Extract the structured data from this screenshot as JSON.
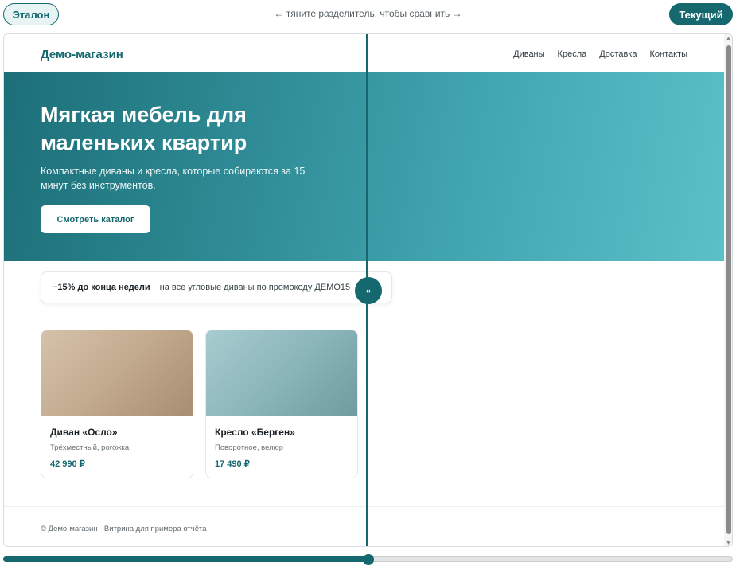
{
  "toolbar": {
    "reference_label": "Эталон",
    "current_label": "Текущий",
    "hint": "← тяните разделитель, чтобы сравнить →"
  },
  "site": {
    "logo": "Демо-магазин",
    "nav": [
      "Диваны",
      "Кресла",
      "Доставка",
      "Контакты"
    ],
    "hero": {
      "title": "Мягкая мебель для маленьких квартир",
      "subtitle": "Компактные диваны и кресла, которые собираются за 15 минут без инструментов.",
      "button": "Смотреть каталог"
    },
    "promo": {
      "strong": "−15% до конца недели",
      "text": "на все угловые диваны по промокоду ДЕМО15"
    },
    "products": [
      {
        "title": "Диван «Осло»",
        "desc": "Трёхместный, рогожка",
        "price": "42 990 ₽"
      },
      {
        "title": "Кресло «Берген»",
        "desc": "Поворотное, велюр",
        "price": "17 490 ₽"
      }
    ],
    "footer": "© Демо-магазин · Витрина для примера отчёта"
  },
  "compare": {
    "handle_icon": "‹›",
    "slider_fraction": 0.5
  },
  "colors": {
    "accent": "#14686e"
  }
}
